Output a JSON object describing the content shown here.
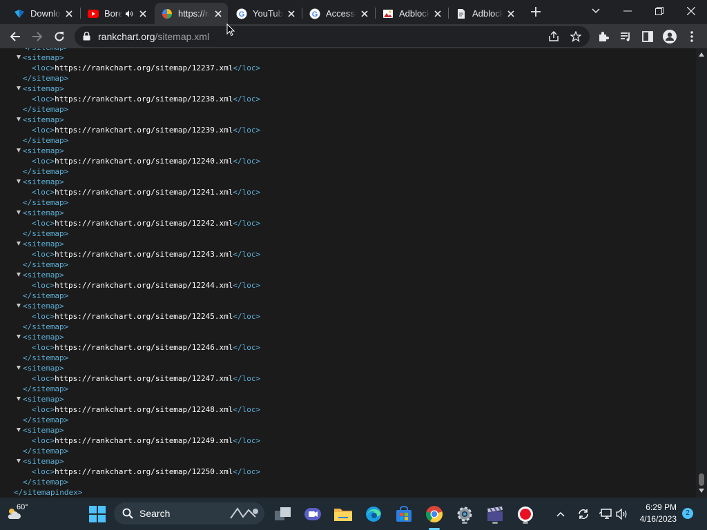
{
  "tabs": [
    {
      "title": "Download",
      "icon": "dart-logo-icon"
    },
    {
      "title": "Bored",
      "icon": "youtube-icon",
      "audio": true
    },
    {
      "title": "https://rankchart.org/sitemap.xml",
      "icon": "rankchart-favicon-icon",
      "active": true
    },
    {
      "title": "YouTube",
      "icon": "google-icon"
    },
    {
      "title": "Accessories",
      "icon": "google-icon"
    },
    {
      "title": "Adblock",
      "icon": "adblock-image-icon"
    },
    {
      "title": "Adblock",
      "icon": "document-icon"
    }
  ],
  "toolbar": {
    "url_host": "rankchart.org",
    "url_path": "/sitemap.xml"
  },
  "xml": {
    "sitemap_open": "<sitemap>",
    "sitemap_close": "</sitemap>",
    "loc_open": "<loc>",
    "loc_close": "</loc>",
    "index_close": "</sitemapindex>",
    "entries": [
      "https://rankchart.org/sitemap/12237.xml",
      "https://rankchart.org/sitemap/12238.xml",
      "https://rankchart.org/sitemap/12239.xml",
      "https://rankchart.org/sitemap/12240.xml",
      "https://rankchart.org/sitemap/12241.xml",
      "https://rankchart.org/sitemap/12242.xml",
      "https://rankchart.org/sitemap/12243.xml",
      "https://rankchart.org/sitemap/12244.xml",
      "https://rankchart.org/sitemap/12245.xml",
      "https://rankchart.org/sitemap/12246.xml",
      "https://rankchart.org/sitemap/12247.xml",
      "https://rankchart.org/sitemap/12248.xml",
      "https://rankchart.org/sitemap/12249.xml",
      "https://rankchart.org/sitemap/12250.xml"
    ]
  },
  "taskbar": {
    "weather_temp": "60°",
    "search_label": "Search",
    "time": "6:29 PM",
    "date": "4/16/2023",
    "notification_count": "2"
  },
  "colors": {
    "xml_tag": "#5db0d7",
    "xml_text": "#ffffff",
    "background": "#1b1b1b"
  }
}
